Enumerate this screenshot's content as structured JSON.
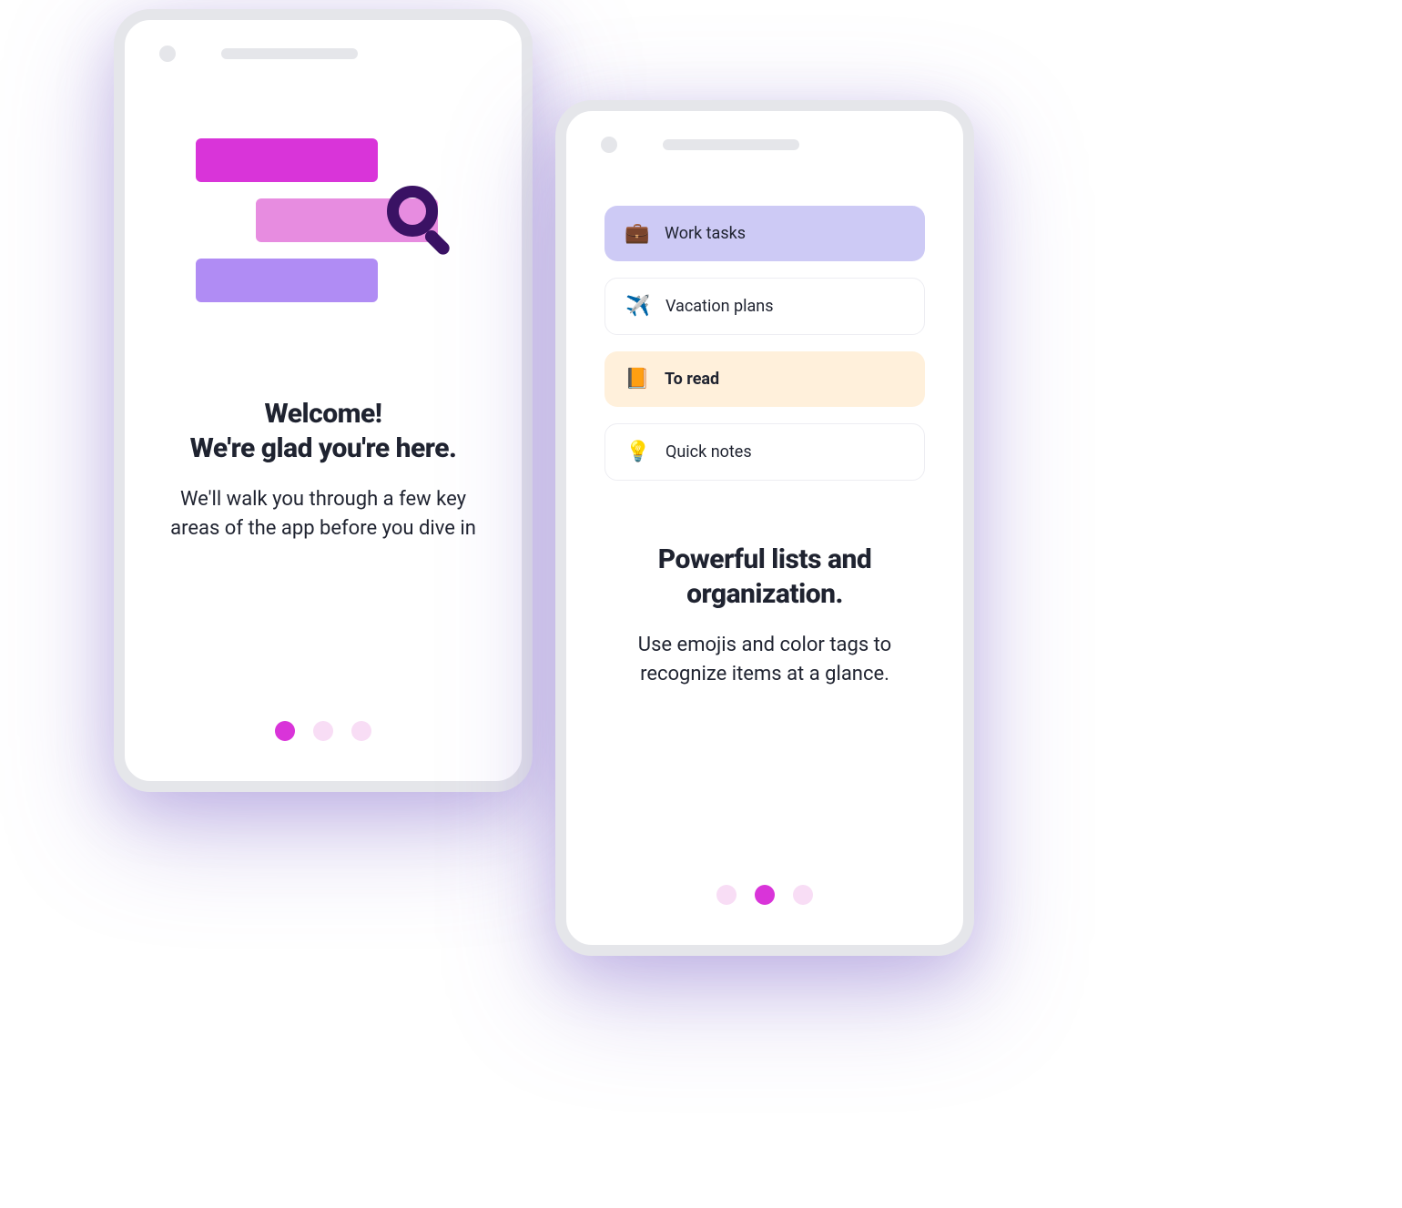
{
  "phone1": {
    "title_line1": "Welcome!",
    "title_line2": "We're glad you're here.",
    "subtitle": "We'll walk you through a few key areas of the app before you dive in",
    "active_dot_index": 0,
    "dot_count": 3,
    "illustration": {
      "bars": [
        {
          "color": "#D934D9"
        },
        {
          "color": "#E78CE0"
        },
        {
          "color": "#B08CF4"
        }
      ],
      "magnify_color": "#3A1264"
    }
  },
  "phone2": {
    "title_line1": "Powerful lists and",
    "title_line2": "organization.",
    "subtitle": "Use emojis and color tags to recognize items at a glance.",
    "active_dot_index": 1,
    "dot_count": 3,
    "list_items": [
      {
        "emoji": "💼",
        "label": "Work tasks",
        "style": "purple"
      },
      {
        "emoji": "✈️",
        "label": "Vacation plans",
        "style": "white"
      },
      {
        "emoji": "📙",
        "label": "To read",
        "style": "cream"
      },
      {
        "emoji": "💡",
        "label": "Quick notes",
        "style": "white"
      }
    ]
  }
}
